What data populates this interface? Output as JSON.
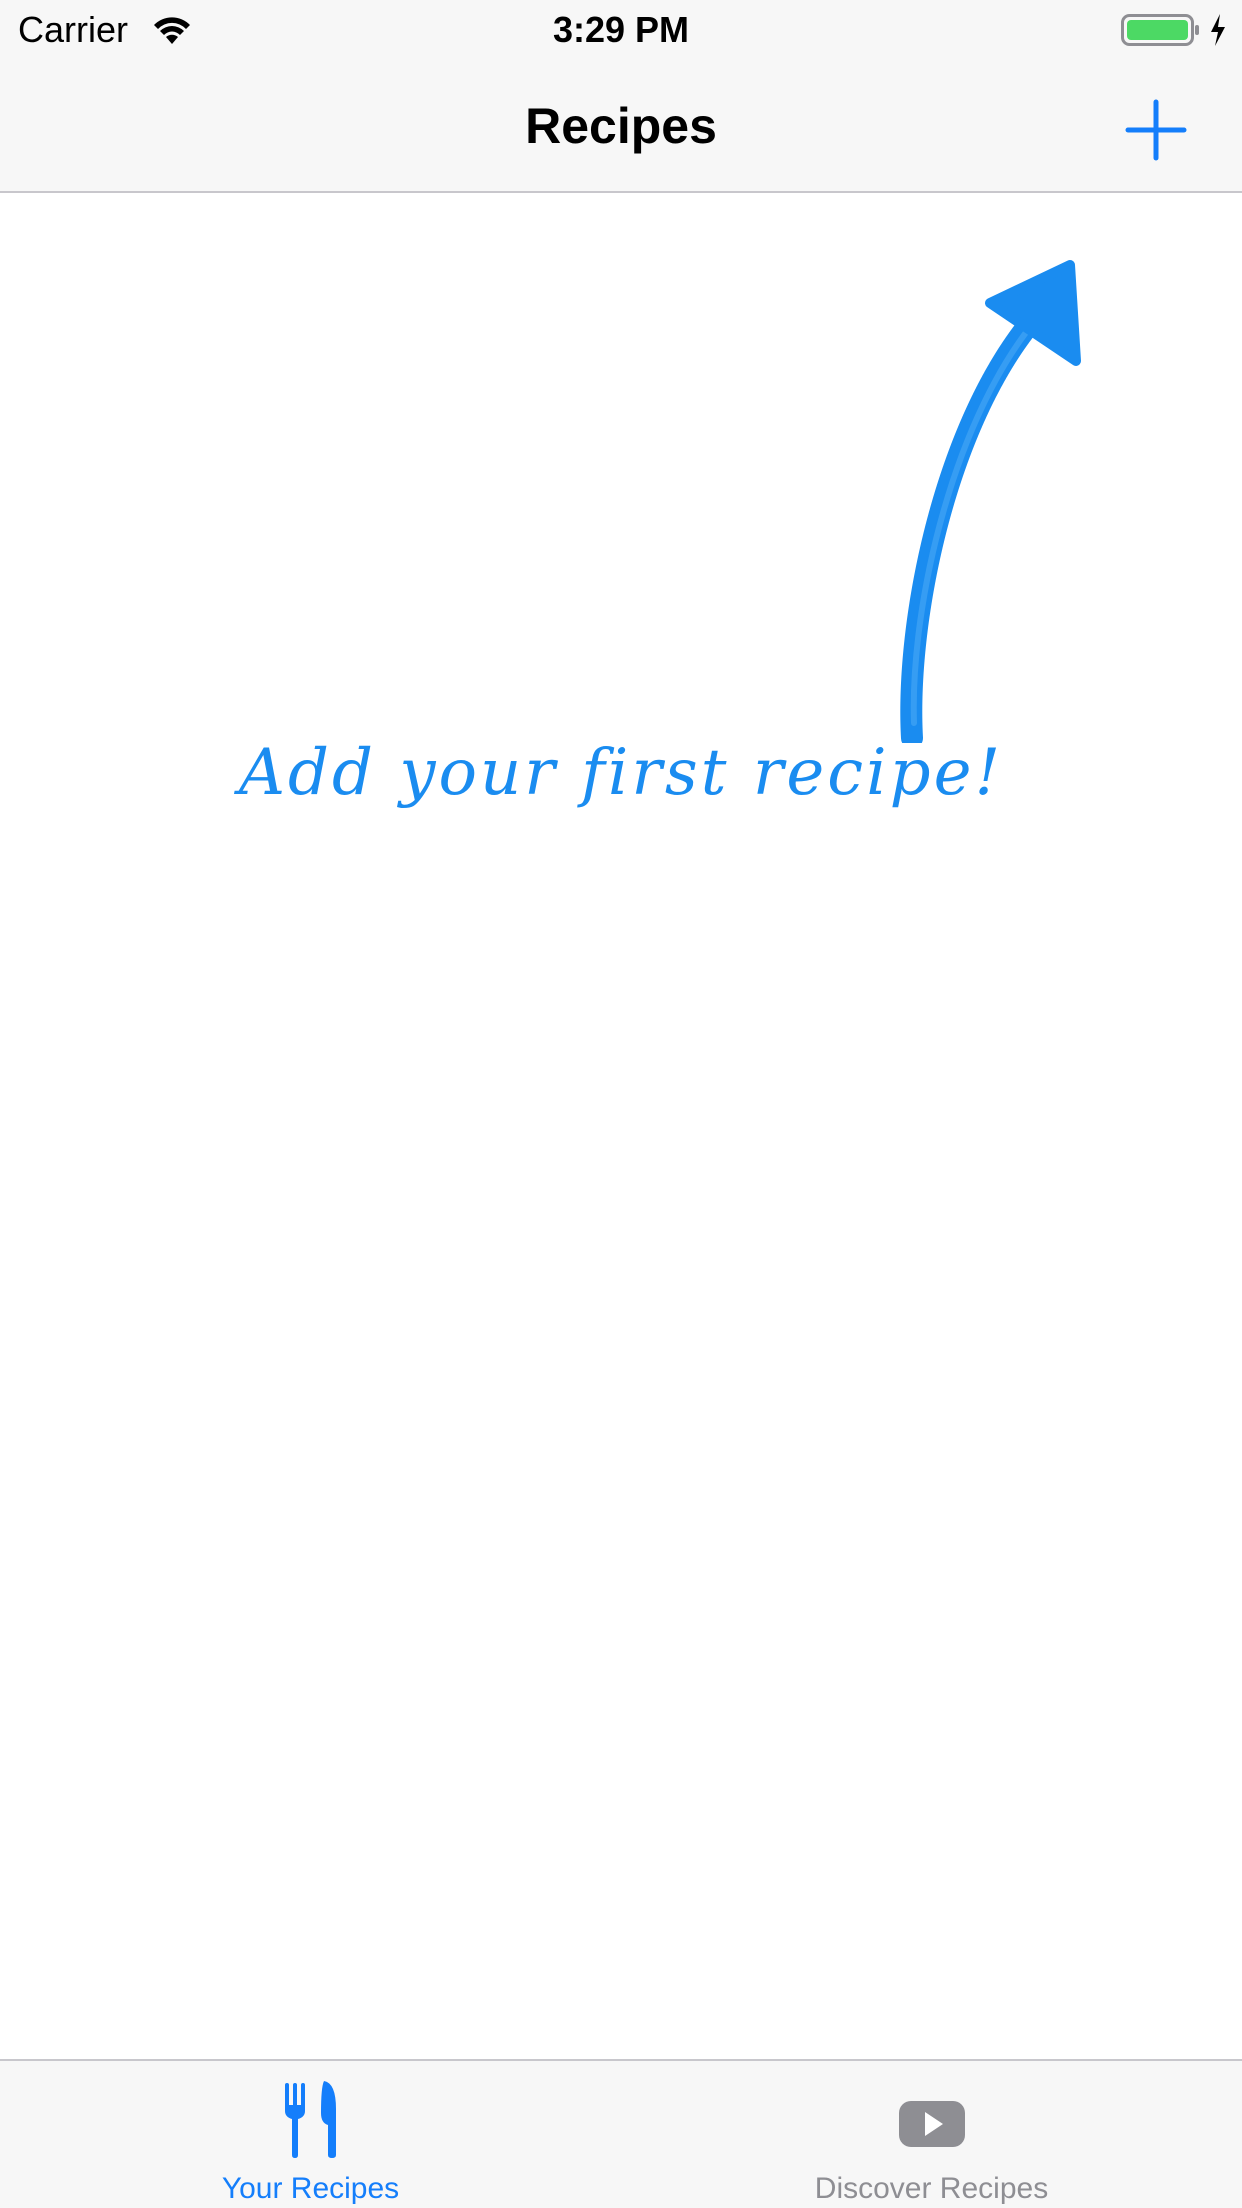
{
  "status_bar": {
    "carrier": "Carrier",
    "time": "3:29 PM",
    "wifi_icon": "wifi-icon",
    "battery_icon": "battery-full-icon",
    "charging_icon": "bolt-icon",
    "battery_color": "#4cd964"
  },
  "nav_bar": {
    "title": "Recipes",
    "add_icon": "plus-icon"
  },
  "empty_state": {
    "hint_text": "Add your first recipe!",
    "pointer_icon": "hand-drawn-arrow",
    "color": "#1a8cf0"
  },
  "tab_bar": {
    "items": [
      {
        "label": "Your Recipes",
        "icon": "fork-knife-icon",
        "selected": true
      },
      {
        "label": "Discover Recipes",
        "icon": "play-video-icon",
        "selected": false
      }
    ]
  },
  "colors": {
    "accent": "#147efb",
    "inactive": "#8e8e93",
    "bar_background": "#f7f7f7"
  }
}
